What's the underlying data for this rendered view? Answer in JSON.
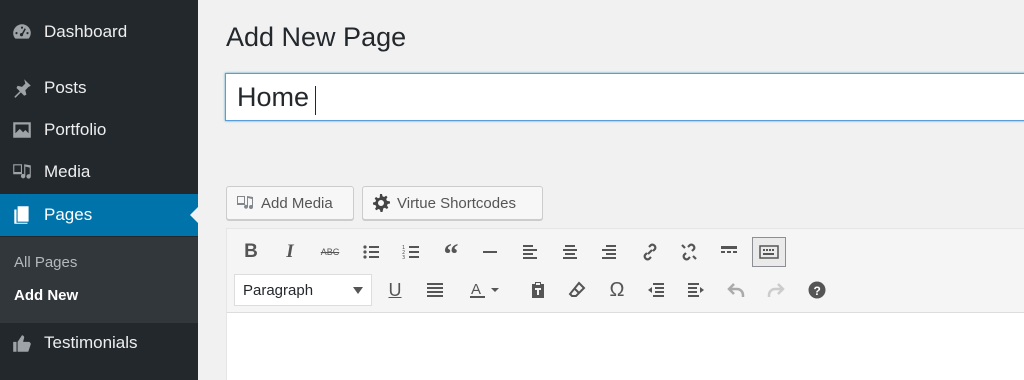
{
  "sidebar": {
    "items": [
      {
        "label": "Dashboard",
        "icon": "dashboard-icon"
      },
      {
        "label": "Posts",
        "icon": "pin-icon"
      },
      {
        "label": "Portfolio",
        "icon": "portfolio-icon"
      },
      {
        "label": "Media",
        "icon": "media-icon"
      },
      {
        "label": "Pages",
        "icon": "pages-icon"
      },
      {
        "label": "Testimonials",
        "icon": "thumbs-up-icon"
      }
    ],
    "submenu": [
      {
        "label": "All Pages"
      },
      {
        "label": "Add New"
      }
    ],
    "current_color": "#0073aa"
  },
  "main": {
    "title": "Add New Page",
    "title_input_value": "Home",
    "buttons": {
      "add_media": "Add Media",
      "shortcodes": "Virtue Shortcodes"
    }
  },
  "editor": {
    "format_value": "Paragraph",
    "row1_icons": [
      "bold-icon",
      "italic-icon",
      "strikethrough-icon",
      "bullet-list-icon",
      "numbered-list-icon",
      "blockquote-icon",
      "horizontal-rule-icon",
      "align-left-icon",
      "align-center-icon",
      "align-right-icon",
      "link-icon",
      "unlink-icon",
      "read-more-icon",
      "toolbar-toggle-icon"
    ],
    "row2_icons": [
      "underline-icon",
      "justify-icon",
      "text-color-icon",
      "paste-text-icon",
      "clear-formatting-icon",
      "special-character-icon",
      "outdent-icon",
      "indent-icon",
      "undo-icon",
      "redo-icon",
      "help-icon"
    ]
  }
}
